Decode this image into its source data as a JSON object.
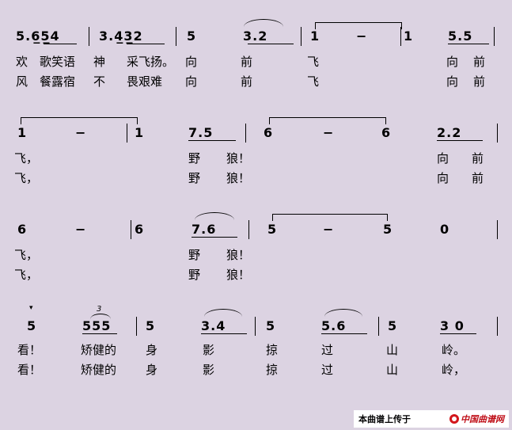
{
  "rows": [
    {
      "notes": [
        "5.6̲5̲4",
        "3.4̲3̲2",
        "5",
        "3.2",
        "1",
        "−",
        "1",
        "5.5"
      ],
      "lyrics1": [
        "欢",
        "歌笑语",
        "神",
        "采飞扬。",
        "向",
        "前",
        "飞",
        "向",
        "前"
      ],
      "lyrics2": [
        "风",
        "餐露宿",
        "不",
        "畏艰难",
        "向",
        "前",
        "飞",
        "向",
        "前"
      ]
    },
    {
      "notes": [
        "1",
        "−",
        "1",
        "7.5",
        "6",
        "−",
        "6",
        "2.2"
      ],
      "lyrics1": [
        "飞，",
        "野",
        "狼！",
        "向",
        "前"
      ],
      "lyrics2": [
        "飞，",
        "野",
        "狼！",
        "向",
        "前"
      ]
    },
    {
      "notes": [
        "6",
        "−",
        "6",
        "7.6",
        "5",
        "−",
        "5",
        "0"
      ],
      "lyrics1": [
        "飞，",
        "野",
        "狼！"
      ],
      "lyrics2": [
        "飞，",
        "野",
        "狼！"
      ]
    },
    {
      "notes": [
        "5",
        "555",
        "5",
        "3.4",
        "5",
        "5.6",
        "5",
        "3 0"
      ],
      "triplet": "3",
      "lyrics1": [
        "看！",
        "矫健的",
        "身",
        "影",
        "掠",
        "过",
        "山",
        "岭。"
      ],
      "lyrics2": [
        "看！",
        "矫健的",
        "身",
        "影",
        "掠",
        "过",
        "山",
        "岭，"
      ]
    }
  ],
  "watermark": {
    "text": "本曲谱上传于",
    "brand": "中国曲谱网"
  }
}
